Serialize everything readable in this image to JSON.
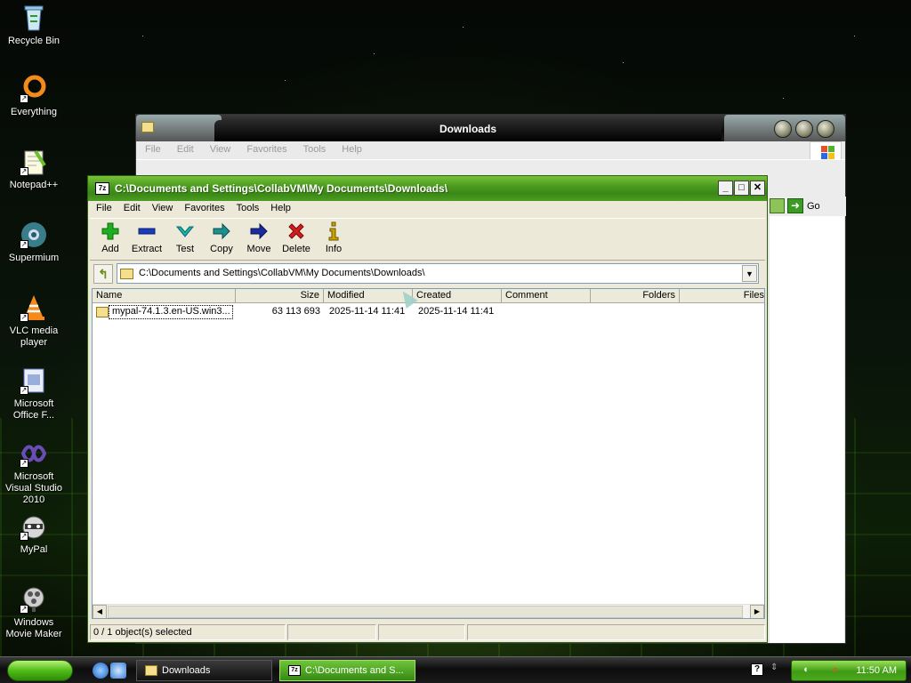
{
  "desktop": {
    "icons": [
      {
        "label": "Recycle Bin",
        "icon": "recycle-bin-icon"
      },
      {
        "label": "Everything",
        "icon": "everything-search-icon"
      },
      {
        "label": "Notepad++",
        "icon": "notepad-plus-plus-icon"
      },
      {
        "label": "Supermium",
        "icon": "supermium-browser-icon"
      },
      {
        "label": "VLC media player",
        "icon": "vlc-cone-icon"
      },
      {
        "label": "Microsoft Office F...",
        "icon": "office-document-icon"
      },
      {
        "label": "Microsoft Visual Studio 2010",
        "icon": "visual-studio-icon"
      },
      {
        "label": "MyPal",
        "icon": "mypal-raccoon-icon"
      },
      {
        "label": "Windows Movie Maker",
        "icon": "movie-maker-film-icon"
      }
    ]
  },
  "explorer": {
    "title": "Downloads",
    "menu": [
      "File",
      "Edit",
      "View",
      "Favorites",
      "Tools",
      "Help"
    ],
    "go_label": "Go"
  },
  "zip": {
    "title": "C:\\Documents and Settings\\CollabVM\\My Documents\\Downloads\\",
    "menu": [
      "File",
      "Edit",
      "View",
      "Favorites",
      "Tools",
      "Help"
    ],
    "toolbar": [
      {
        "label": "Add",
        "icon": "plus-icon",
        "color": "#1fae1f"
      },
      {
        "label": "Extract",
        "icon": "minus-icon",
        "color": "#1b3bbd"
      },
      {
        "label": "Test",
        "icon": "check-icon",
        "color": "#17b3b3"
      },
      {
        "label": "Copy",
        "icon": "double-arrow-icon",
        "color": "#1d8f8f"
      },
      {
        "label": "Move",
        "icon": "arrow-right-icon",
        "color": "#1b2a9e"
      },
      {
        "label": "Delete",
        "icon": "x-icon",
        "color": "#d11d1d"
      },
      {
        "label": "Info",
        "icon": "info-icon",
        "color": "#c9a400"
      }
    ],
    "address": "C:\\Documents and Settings\\CollabVM\\My Documents\\Downloads\\",
    "columns": [
      "Name",
      "Size",
      "Modified",
      "Created",
      "Comment",
      "Folders",
      "Files"
    ],
    "rows": [
      {
        "name": "mypal-74.1.3.en-US.win3...",
        "size": "63 113 693",
        "modified": "2025-11-14 11:41",
        "created": "2025-11-14 11:41",
        "comment": "",
        "folders": "",
        "files": ""
      }
    ],
    "status": "0 / 1 object(s) selected"
  },
  "taskbar": {
    "tasks": [
      {
        "label": "Downloads",
        "icon": "folder-icon"
      },
      {
        "label": "C:\\Documents and S...",
        "icon": "7zip-icon"
      }
    ],
    "clock": "11:50 AM"
  },
  "colors": {
    "zip_title_green": "#4a9b1f",
    "explorer_title_black": "#0a0a0a",
    "selection_outline": "#000000"
  }
}
